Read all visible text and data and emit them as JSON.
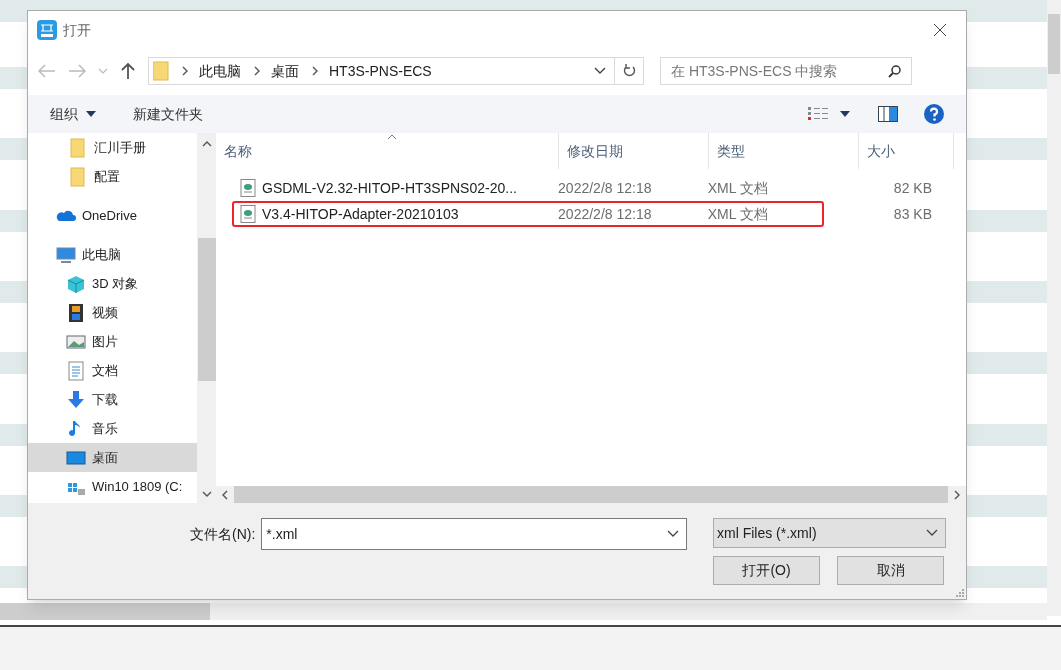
{
  "window": {
    "title": "打开"
  },
  "address": {
    "path": [
      "此电脑",
      "桌面",
      "HT3S-PNS-ECS"
    ]
  },
  "search": {
    "placeholder": "在 HT3S-PNS-ECS 中搜索"
  },
  "toolbar": {
    "organize": "组织",
    "new_folder": "新建文件夹"
  },
  "sidebar": {
    "items": [
      {
        "label": "汇川手册",
        "kind": "folder",
        "selected": false
      },
      {
        "label": "配置",
        "kind": "folder",
        "selected": false
      },
      {
        "label": "OneDrive",
        "kind": "cloud",
        "selected": false
      },
      {
        "label": "此电脑",
        "kind": "computer",
        "selected": false
      },
      {
        "label": "3D 对象",
        "kind": "cube",
        "selected": false
      },
      {
        "label": "视频",
        "kind": "film",
        "selected": false
      },
      {
        "label": "图片",
        "kind": "image",
        "selected": false
      },
      {
        "label": "文档",
        "kind": "document",
        "selected": false
      },
      {
        "label": "下载",
        "kind": "download",
        "selected": false
      },
      {
        "label": "音乐",
        "kind": "music",
        "selected": false
      },
      {
        "label": "桌面",
        "kind": "desktop",
        "selected": true
      },
      {
        "label": "Win10 1809 (C:",
        "kind": "drive",
        "selected": false
      }
    ]
  },
  "table": {
    "columns": [
      "名称",
      "修改日期",
      "类型",
      "大小"
    ],
    "rows": [
      {
        "name": "GSDML-V2.32-HITOP-HT3SPNS02-20...",
        "modified": "2022/2/8 12:18",
        "type": "XML 文档",
        "size": "82 KB",
        "highlighted": false
      },
      {
        "name": "V3.4-HITOP-Adapter-20210103",
        "modified": "2022/2/8 12:18",
        "type": "XML 文档",
        "size": "83 KB",
        "highlighted": true
      }
    ]
  },
  "filename": {
    "label": "文件名(N):",
    "value": "*.xml"
  },
  "filter": {
    "value": "xml Files (*.xml)"
  },
  "buttons": [
    "打开(O)",
    "取消"
  ]
}
